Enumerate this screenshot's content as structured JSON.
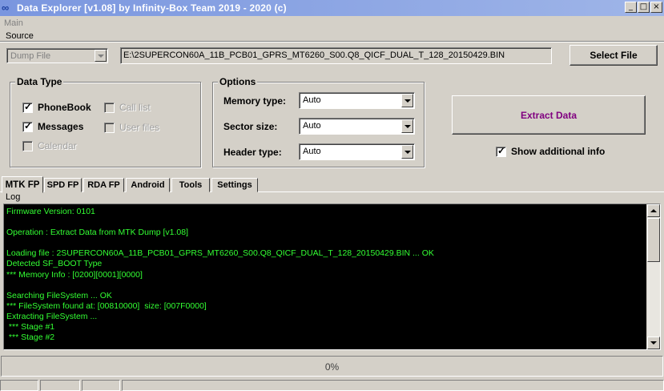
{
  "window": {
    "title": "Data Explorer  [v1.08] by Infinity-Box Team 2019 - 2020 (c)",
    "icon": "infinity-icon",
    "min_label": "_",
    "max_label": "□",
    "close_label": "×"
  },
  "menu": {
    "main": "Main"
  },
  "source": {
    "label": "Source",
    "mode": "Dump File",
    "path": "E:\\2SUPERCON60A_11B_PCB01_GPRS_MT6260_S00.Q8_QICF_DUAL_T_128_20150429.BIN",
    "select_button": "Select File"
  },
  "data_type": {
    "title": "Data Type",
    "items": [
      {
        "label": "PhoneBook",
        "checked": true,
        "enabled": true
      },
      {
        "label": "Messages",
        "checked": true,
        "enabled": true
      },
      {
        "label": "Calendar",
        "checked": false,
        "enabled": false
      },
      {
        "label": "Call list",
        "checked": false,
        "enabled": false
      },
      {
        "label": "User files",
        "checked": false,
        "enabled": false
      }
    ]
  },
  "options": {
    "title": "Options",
    "memory_type_label": "Memory type:",
    "memory_type": "Auto",
    "sector_size_label": "Sector size:",
    "sector_size": "Auto",
    "header_type_label": "Header type:",
    "header_type": "Auto"
  },
  "extract_button": "Extract Data",
  "extract_color": "#800080",
  "show_info": {
    "label": "Show additional info",
    "checked": true
  },
  "tabs": [
    "MTK FP",
    "SPD FP",
    "RDA FP",
    "Android",
    "Tools",
    "Settings"
  ],
  "log": {
    "label": "Log",
    "lines": [
      "Firmware Version: 0101",
      "",
      "Operation : Extract Data from MTK Dump [v1.08]",
      "",
      "Loading file : 2SUPERCON60A_11B_PCB01_GPRS_MT6260_S00.Q8_QICF_DUAL_T_128_20150429.BIN ... OK",
      "Detected SF_BOOT Type",
      "*** Memory Info : [0200][0001][0000]",
      "",
      "Searching FileSystem ... OK",
      "*** FileSystem found at: [00810000]  size: [007F0000]",
      "Extracting FileSystem ...",
      " *** Stage #1",
      " *** Stage #2"
    ],
    "text_color": "#33ff33"
  },
  "progress": {
    "value": 0,
    "text": "0%"
  }
}
